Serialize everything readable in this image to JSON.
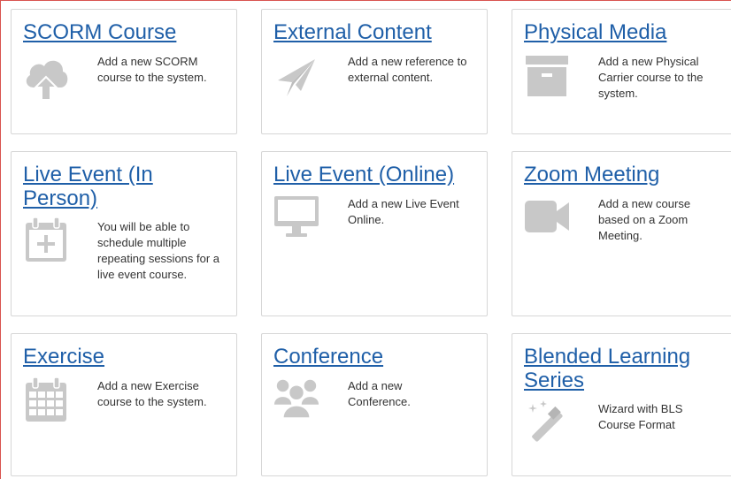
{
  "tiles": [
    {
      "title": "SCORM Course",
      "description": "Add a new SCORM course to the system.",
      "icon": "cloud-upload-icon"
    },
    {
      "title": "External Content",
      "description": "Add a new reference to external content.",
      "icon": "paper-plane-icon"
    },
    {
      "title": "Physical Media",
      "description": "Add a new Physical Carrier course to the system.",
      "icon": "archive-box-icon"
    },
    {
      "title": "Live Event (In Person)",
      "description": "You will be able to schedule multiple repeating sessions for a live event course.",
      "icon": "calendar-plus-icon"
    },
    {
      "title": "Live Event (Online)",
      "description": "Add a new Live Event Online.",
      "icon": "desktop-monitor-icon"
    },
    {
      "title": "Zoom Meeting",
      "description": "Add a new course based on a Zoom Meeting.",
      "icon": "video-camera-icon"
    },
    {
      "title": "Exercise",
      "description": "Add a new Exercise course to the system.",
      "icon": "calendar-grid-icon"
    },
    {
      "title": "Conference",
      "description": "Add a new Conference.",
      "icon": "users-group-icon"
    },
    {
      "title": "Blended Learning Series",
      "description": "Wizard with BLS Course Format",
      "icon": "magic-wand-icon"
    }
  ],
  "colors": {
    "link": "#1f5fa8",
    "icon": "#c8c8c8",
    "border": "#d6d6d6"
  }
}
